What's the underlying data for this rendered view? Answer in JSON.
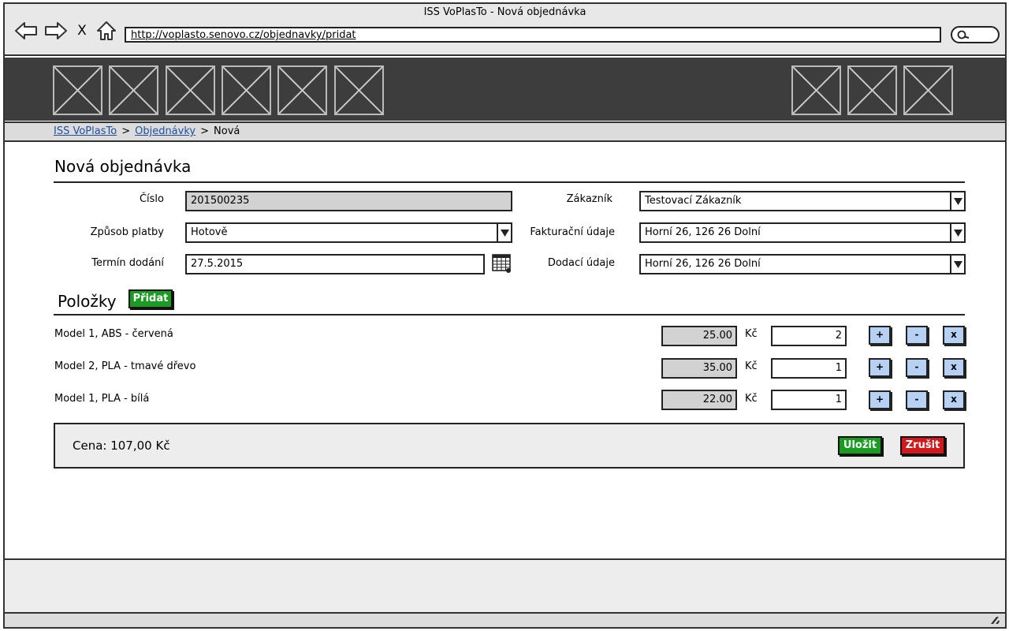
{
  "window": {
    "title": "ISS VoPlasTo - Nová objednávka"
  },
  "browser": {
    "url": "http://voplasto.senovo.cz/objednavky/pridat",
    "close_symbol": "X"
  },
  "breadcrumb": {
    "items": [
      "ISS VoPlasTo",
      "Objednávky"
    ],
    "separator": ">",
    "current": "Nová"
  },
  "page": {
    "title": "Nová objednávka"
  },
  "form": {
    "cislo": {
      "label": "Číslo",
      "value": "201500235"
    },
    "zpusob_platby": {
      "label": "Způsob platby",
      "value": "Hotově"
    },
    "termin_dodani": {
      "label": "Termín dodání",
      "value": "27.5.2015"
    },
    "zakaznik": {
      "label": "Zákazník",
      "value": "Testovací Zákazník"
    },
    "fakturacni_udaje": {
      "label": "Fakturační údaje",
      "value": "Horní 26, 126 26 Dolní"
    },
    "dodaci_udaje": {
      "label": "Dodací údaje",
      "value": "Horní 26, 126 26 Dolní"
    }
  },
  "items_section": {
    "title": "Položky",
    "add_label": "Přidat",
    "currency": "Kč",
    "plus_label": "+",
    "minus_label": "-",
    "remove_label": "x",
    "items": [
      {
        "name": "Model 1, ABS - červená",
        "price": "25.00",
        "qty": "2"
      },
      {
        "name": "Model 2, PLA - tmavé dřevo",
        "price": "35.00",
        "qty": "1"
      },
      {
        "name": "Model 1, PLA - bílá",
        "price": "22.00",
        "qty": "1"
      }
    ]
  },
  "summary": {
    "total": "Cena: 107,00 Kč",
    "save_label": "Uložit",
    "cancel_label": "Zrušit"
  },
  "colors": {
    "header_dark": "#3d3d3d",
    "save_green": "#1a9c23",
    "cancel_red": "#d0191c",
    "small_button_blue": "#b7d1f4",
    "readonly_gray": "#d2d2d2"
  }
}
